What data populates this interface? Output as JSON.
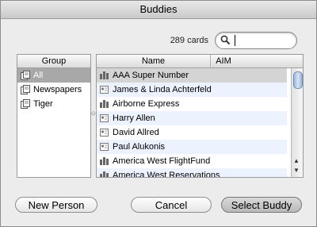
{
  "window": {
    "title": "Buddies"
  },
  "search": {
    "count": "289 cards",
    "value": ""
  },
  "groups": {
    "header": "Group",
    "items": [
      {
        "label": "All",
        "icon": "group-all-icon",
        "selected": true
      },
      {
        "label": "Newspapers",
        "icon": "group-icon",
        "selected": false
      },
      {
        "label": "Tiger",
        "icon": "group-icon",
        "selected": false
      }
    ]
  },
  "names": {
    "header_name": "Name",
    "header_aim": "AIM",
    "rows": [
      {
        "label": "AAA Super Number",
        "icon": "company-icon"
      },
      {
        "label": "James & Linda Achterfeld",
        "icon": "person-card-icon"
      },
      {
        "label": "Airborne Express",
        "icon": "company-icon"
      },
      {
        "label": "Harry Allen",
        "icon": "person-card-icon"
      },
      {
        "label": "David Allred",
        "icon": "person-card-icon"
      },
      {
        "label": "Paul Alukonis",
        "icon": "person-card-icon"
      },
      {
        "label": "America West FlightFund",
        "icon": "company-icon"
      },
      {
        "label": "America West Reservations",
        "icon": "company-icon"
      }
    ]
  },
  "buttons": {
    "new_person": "New Person",
    "cancel": "Cancel",
    "select_buddy": "Select Buddy"
  }
}
